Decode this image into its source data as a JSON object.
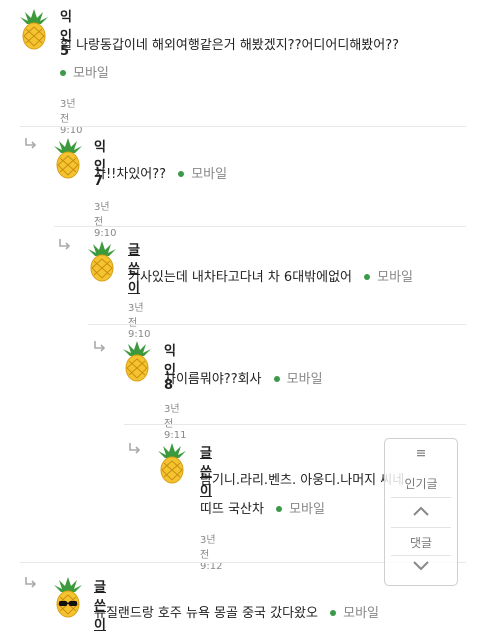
{
  "comments": [
    {
      "author": "익인5",
      "text": "헐 나랑동갑이네 해외여행같은거 해봤겠지??어디어디해봤어??",
      "mobile": "모바일",
      "time": "3년 전 9:10"
    },
    {
      "author": "익인7",
      "text": "차!!차있어??",
      "mobile": "모바일",
      "time": "3년 전 9:10"
    },
    {
      "author": "글쓴이",
      "text": "기사있는데 내차타고다녀 차 6대밖에없어",
      "mobile": "모바일",
      "time": "3년 전 9:10"
    },
    {
      "author": "익인8",
      "text": "차이름뭐야??회사",
      "mobile": "모바일",
      "time": "3년 전 9:11"
    },
    {
      "author": "글쓴이",
      "text": "람기니.라리.벤츠. 아웅디.나머지 씨네",
      "text2": "띠뜨 국산차",
      "mobile": "모바일",
      "time": "3년 전 9:12"
    },
    {
      "author": "글쓴이",
      "text": "뉴질랜드랑 호주 뉴욕 몽골 중국 갔다왔오",
      "mobile": "모바일"
    }
  ],
  "float_panel": {
    "popular_label": "인기글",
    "comments_label": "댓글"
  },
  "icons": {
    "avatar": "pineapple-icon",
    "avatar_sunglasses": "pineapple-sunglasses-icon",
    "reply": "reply-arrow-icon",
    "menu": "menu-icon",
    "up": "chevron-up-icon",
    "down": "chevron-down-icon"
  },
  "colors": {
    "mobile_dot": "#3a9a4a",
    "pineapple": "#f4c430",
    "leaf": "#3c9a3c"
  }
}
